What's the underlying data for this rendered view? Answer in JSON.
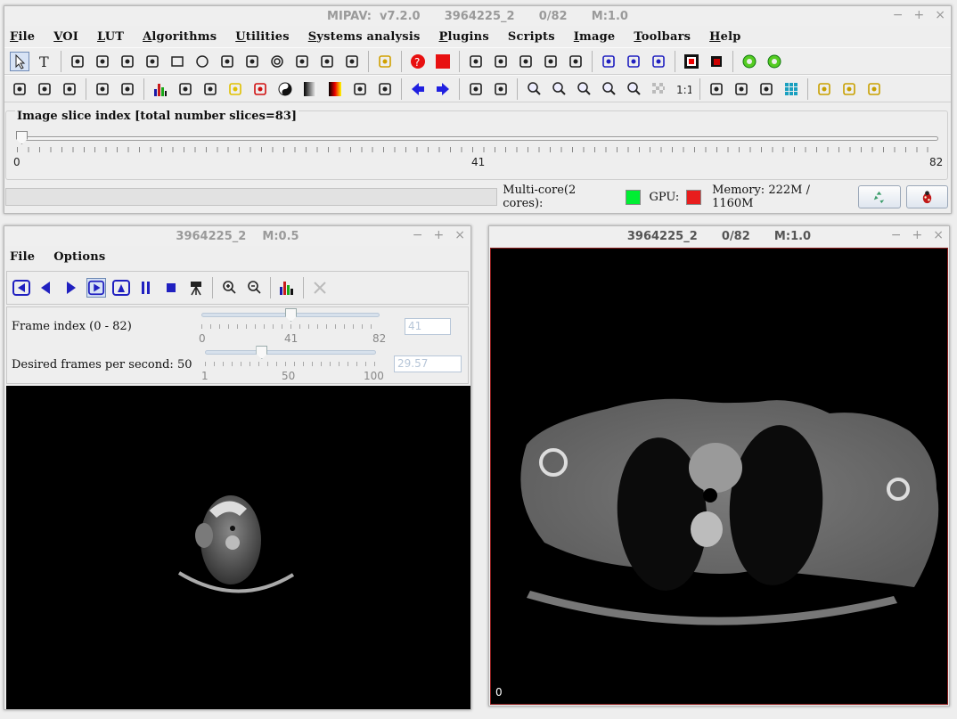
{
  "main_window": {
    "title": "MIPAV:  v7.2.0      3964225_2      0/82      M:1.0",
    "menus": [
      {
        "pre": "",
        "u": "F",
        "post": "ile"
      },
      {
        "pre": "",
        "u": "V",
        "post": "OI"
      },
      {
        "pre": "",
        "u": "L",
        "post": "UT"
      },
      {
        "pre": "",
        "u": "A",
        "post": "lgorithms"
      },
      {
        "pre": "",
        "u": "U",
        "post": "tilities"
      },
      {
        "pre": "",
        "u": "S",
        "post": "ystems analysis"
      },
      {
        "pre": "",
        "u": "P",
        "post": "lugins"
      },
      {
        "pre": "",
        "u": "",
        "post": "Scripts"
      },
      {
        "pre": "",
        "u": "I",
        "post": "mage"
      },
      {
        "pre": "",
        "u": "T",
        "post": "oolbars"
      },
      {
        "pre": "",
        "u": "H",
        "post": "elp"
      }
    ],
    "toolbar1_icons": [
      "pointer-icon",
      "text-icon",
      "sep",
      "segment-icon",
      "quick-mask-icon",
      "line-icon",
      "protractor-icon",
      "rectangle-icon",
      "ellipse-icon",
      "polygon-icon",
      "polyline-icon",
      "concentric-icon",
      "livewire-icon",
      "cube-icon",
      "brush-icon",
      "sep",
      "new-voi-icon",
      "sep",
      "help-icon",
      "red-square-icon",
      "sep",
      "undo-icon",
      "redo-icon",
      "cut-icon",
      "copy-icon",
      "paste-icon",
      "sep",
      "propagate-back-icon",
      "propagate-both-icon",
      "propagate-forward-icon",
      "sep",
      "color-box-icon",
      "color-small-icon",
      "sep",
      "green-ring-icon",
      "green-ring2-icon"
    ],
    "toolbar2_icons": [
      "open-icon",
      "save-icon",
      "camera-icon",
      "sep",
      "export-icon",
      "tree-icon",
      "sep",
      "histogram-icon",
      "ct-icon",
      "window-level-icon",
      "yellow-lut-icon",
      "red-lut-icon",
      "yin-yang-icon",
      "gray-gradient-icon",
      "hot-gradient-icon",
      "open-lut-icon",
      "save-lut-icon",
      "sep",
      "arrow-left-icon",
      "arrow-right-icon",
      "sep",
      "tools-icon",
      "swap-icon",
      "sep",
      "zoom-in-icon",
      "zoom-out-icon",
      "zoom-fit-icon",
      "zoom-region-icon",
      "zoom-mag-icon",
      "checker-icon",
      "one-to-one-icon",
      "sep",
      "info-icon",
      "head-icon",
      "skull-icon",
      "grid-icon",
      "sep",
      "microscope-icon",
      "microscope2-icon",
      "microscope3-icon"
    ],
    "slider": {
      "title": "Image slice index  [total number slices=83]",
      "min": "0",
      "mid": "41",
      "max": "82",
      "value_fraction": 0.0
    },
    "status": {
      "multicore": "Multi-core(2 cores):",
      "multicore_color": "#00ee33",
      "gpu": "GPU:",
      "gpu_color": "#e81d1d",
      "memory": "Memory: 222M / 1160M"
    }
  },
  "animate_window": {
    "title": "3964225_2    M:0.5",
    "menus": [
      "File",
      "Options"
    ],
    "frame_label": "Frame index (0 - 82)",
    "frame_ticks": [
      "0",
      "41",
      "82"
    ],
    "frame_value": "41",
    "frame_fraction": 0.5,
    "fps_label": "Desired frames per second: 50",
    "fps_ticks": [
      "1",
      "50",
      "100"
    ],
    "fps_value": "29.57",
    "fps_fraction": 0.33
  },
  "image_window": {
    "title": "3964225_2      0/82      M:1.0",
    "slice_label": "0"
  }
}
